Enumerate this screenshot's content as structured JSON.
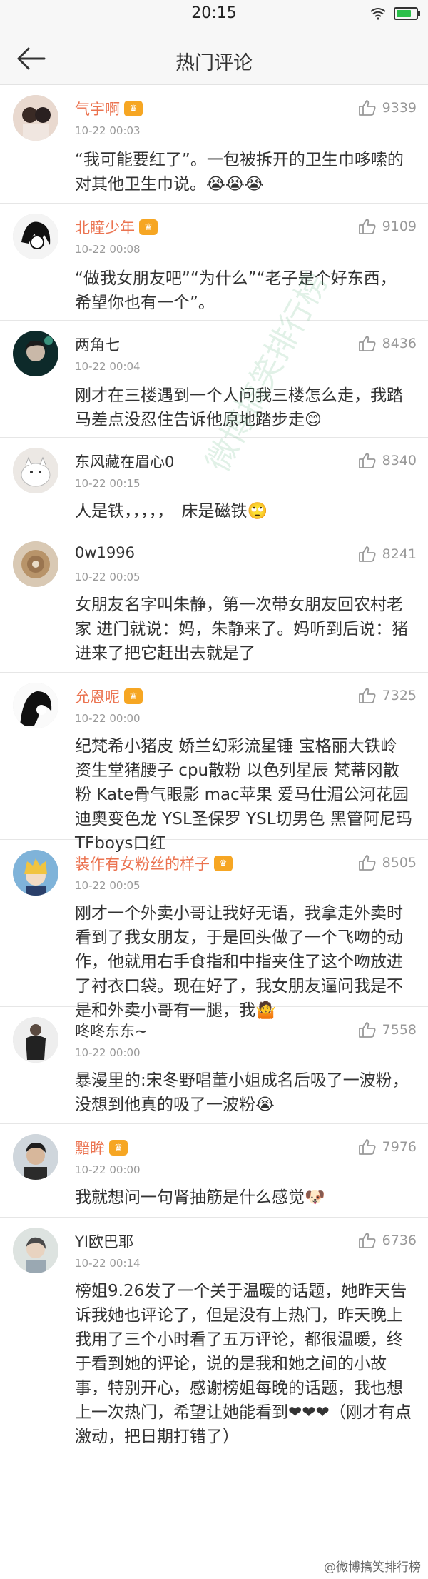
{
  "status": {
    "time": "20:15"
  },
  "nav": {
    "title": "热门评论"
  },
  "comments": [
    {
      "user": "气宇啊",
      "time": "10-22 00:03",
      "likes": "9339",
      "text": "“我可能要红了”。一包被拆开的卫生巾哆嗦的对其他卫生巾说。😭😭😭"
    },
    {
      "user": "北瞳少年",
      "time": "10-22 00:08",
      "likes": "9109",
      "text": "“做我女朋友吧”“为什么”“老子是个好东西，希望你也有一个”。"
    },
    {
      "user": "两角七",
      "time": "10-22 00:04",
      "likes": "8436",
      "text": "刚才在三楼遇到一个人问我三楼怎么走，我踏马差点没忍住告诉他原地踏步走😊"
    },
    {
      "user": "东风藏在眉心0",
      "time": "10-22 00:15",
      "likes": "8340",
      "text": "人是铁，，，，，　床是磁铁🙄"
    },
    {
      "user": "0w1996",
      "time": "10-22 00:05",
      "likes": "8241",
      "text": "女朋友名字叫朱静，第一次带女朋友回农村老家 进门就说：妈，朱静来了。妈听到后说：猪进来了把它赶出去就是了"
    },
    {
      "user": "允恩呢",
      "time": "10-22 00:00",
      "likes": "7325",
      "text": "纪梵希小猪皮 娇兰幻彩流星锤 宝格丽大铁岭 资生堂猪腰子 cpu散粉 以色列星辰 梵蒂冈散粉 Kate骨气眼影 mac苹果 爱马仕湄公河花园 迪奥变色龙 YSL圣保罗 YSL切男色 黑管阿尼玛 TFboys口红"
    },
    {
      "user": "装作有女粉丝的样子",
      "time": "10-22 00:05",
      "likes": "8505",
      "text": "刚才一个外卖小哥让我好无语，我拿走外卖时看到了我女朋友，于是回头做了一个飞吻的动作，他就用右手食指和中指夹住了这个吻放进了衬衣口袋。现在好了，我女朋友逼问我是不是和外卖小哥有一腿，我🤷"
    },
    {
      "user": "咚咚东东~",
      "time": "10-22 00:00",
      "likes": "7558",
      "text": "暴漫里的:宋冬野唱董小姐成名后吸了一波粉，　没想到他真的吸了一波粉😭"
    },
    {
      "user": "黯眸",
      "time": "10-22 00:00",
      "likes": "7976",
      "text": "我就想问一句肾抽筋是什么感觉🐶"
    },
    {
      "user": "YI欧巴耶",
      "time": "10-22 00:14",
      "likes": "6736",
      "text": "榜姐9.26发了一个关于温暖的话题，她昨天告诉我她也评论了，但是没有上热门，昨天晚上我用了三个小时看了五万评论，都很温暖，终于看到她的评论，说的是我和她之间的小故事，特别开心，感谢榜姐每晚的话题，我也想上一次热门，希望让她能看到❤❤❤（刚才有点激动，把日期打错了）"
    }
  ],
  "watermark": "微博搞笑排行榜",
  "credit": "@微博搞笑排行榜"
}
